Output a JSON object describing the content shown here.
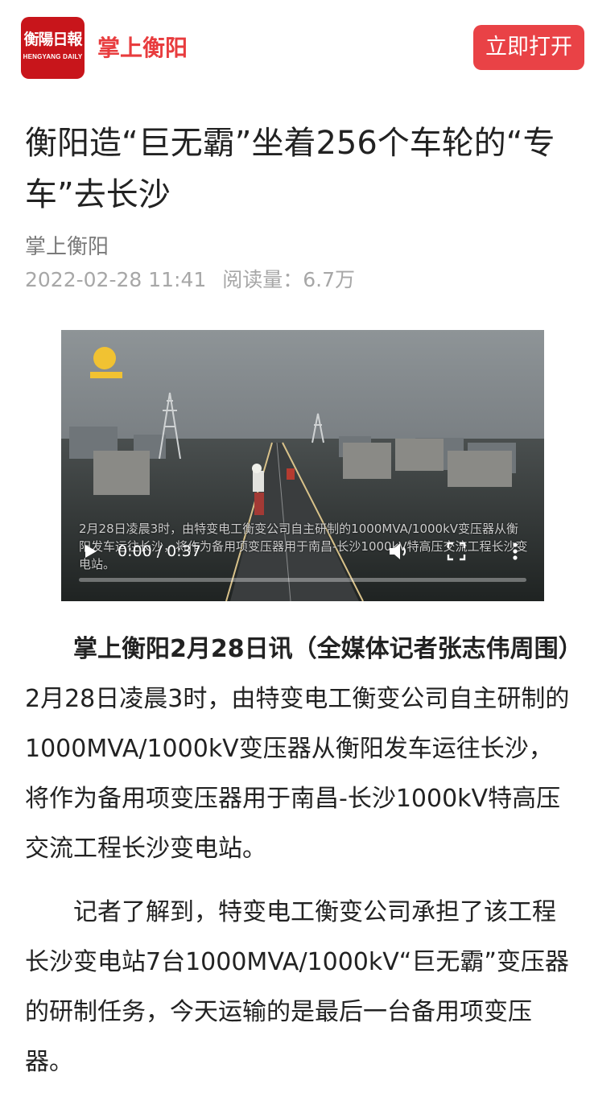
{
  "header": {
    "logo_text_cn": "衡陽日報",
    "logo_text_en": "HENGYANG DAILY",
    "brand": "掌上衡阳",
    "open_button": "立即打开",
    "brand_color": "#e83c3e",
    "logo_color": "#c8151b"
  },
  "article": {
    "title": "衡阳造“巨无霸”坐着256个车轮的“专车”去长沙",
    "source": "掌上衡阳",
    "date": "2022-02-28 11:41",
    "views": "阅读量：6.7万"
  },
  "video": {
    "caption": "2月28日凌晨3时，由特变电工衡变公司自主研制的1000MVA/1000kV变压器从衡阳发车运往长沙，将作为备用项变压器用于南昌-长沙1000kV特高压交流工程长沙变电站。",
    "time": "0:00 / 0:37",
    "progress_fraction": 0,
    "play_icon": "play-icon",
    "volume_icon": "volume-icon",
    "fullscreen_icon": "fullscreen-icon",
    "more_icon": "more-vertical-icon"
  },
  "body": {
    "p1_lead": "掌上衡阳2月28日讯（全媒体记者张志伟周围）",
    "p1_text": "　2月28日凌晨3时，由特变电工衡变公司自主研制的1000MVA/1000kV变压器从衡阳发车运往长沙，将作为备用项变压器用于南昌-长沙1000kV特高压交流工程长沙变电站。",
    "p2": "记者了解到，特变电工衡变公司承担了该工程长沙变电站7台1000MVA/1000kV“巨无霸”变压器的研制任务，今天运输的是最后一台备用项变压器。"
  }
}
